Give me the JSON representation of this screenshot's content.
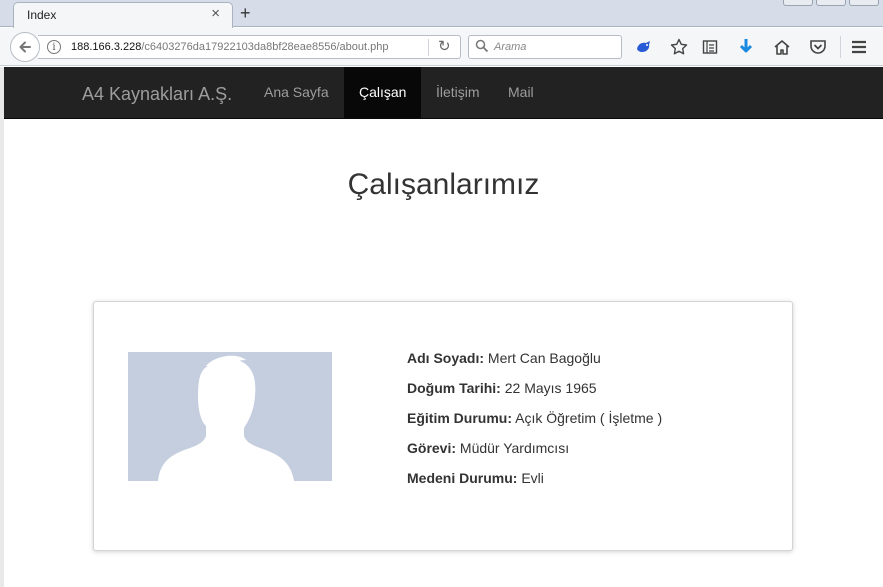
{
  "browser": {
    "tab_title": "Index",
    "tab_close": "×",
    "new_tab": "+",
    "url_host": "188.166.3.228",
    "url_path": "/c6403276da17922103da8bf28eae8556/about.php",
    "search_placeholder": "Arama"
  },
  "navbar": {
    "brand": "A4 Kaynakları A.Ş.",
    "items": [
      {
        "label": "Ana Sayfa"
      },
      {
        "label": "Çalışan"
      },
      {
        "label": "İletişim"
      },
      {
        "label": "Mail"
      }
    ],
    "active_index": 1
  },
  "page": {
    "title": "Çalışanlarımız"
  },
  "employee": {
    "name_label": "Adı Soyadı:",
    "name_value": "Mert Can Bagoğlu",
    "birth_label": "Doğum Tarihi:",
    "birth_value": "22 Mayıs 1965",
    "education_label": "Eğitim Durumu:",
    "education_value": "Açık Öğretim ( İşletme )",
    "position_label": "Görevi:",
    "position_value": "Müdür Yardımcısı",
    "marital_label": "Medeni Durumu:",
    "marital_value": "Evli"
  },
  "colors": {
    "navbar_bg": "#222222",
    "navbar_active_bg": "#080808",
    "avatar_bg": "#c5cedf"
  }
}
